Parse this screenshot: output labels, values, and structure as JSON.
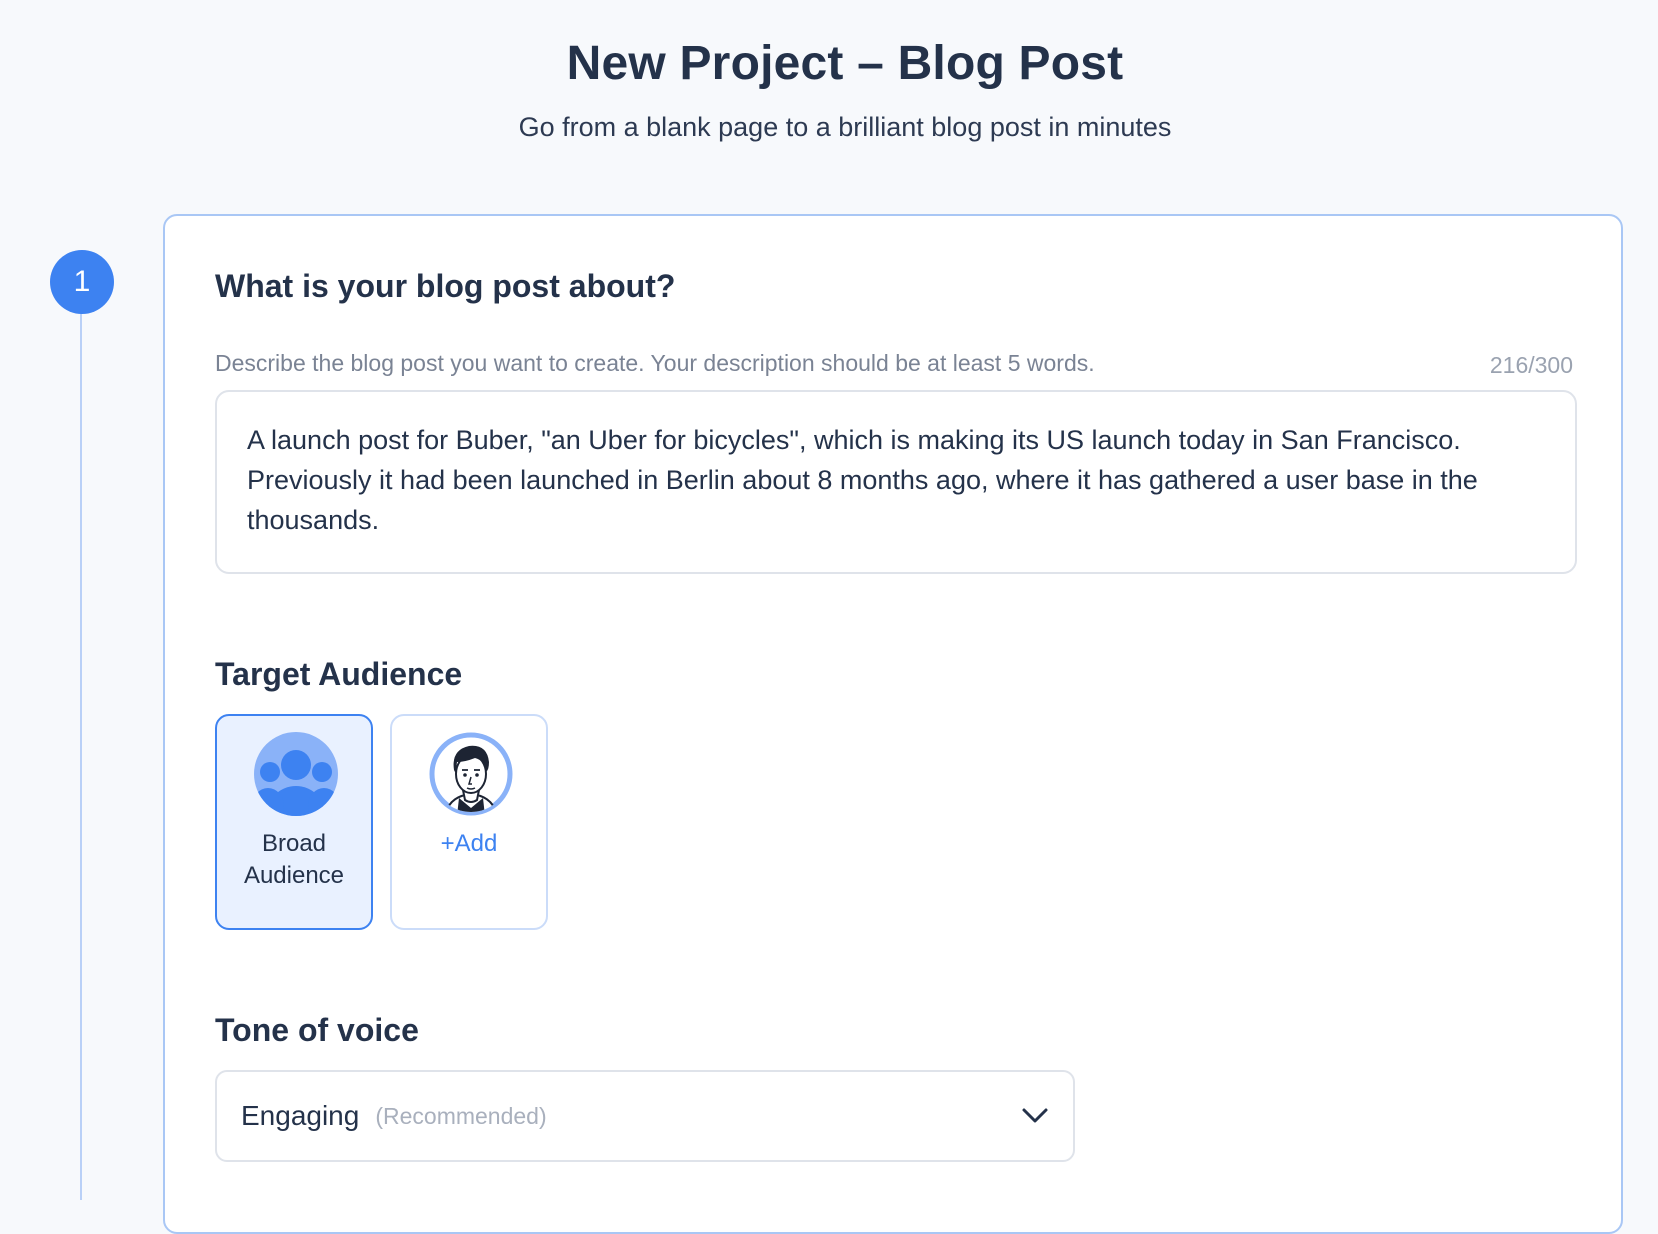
{
  "header": {
    "title": "New Project – Blog Post",
    "subtitle": "Go from a blank page to a brilliant blog post in minutes"
  },
  "step": {
    "number": "1"
  },
  "description": {
    "heading": "What is your blog post about?",
    "helper": "Describe the blog post you want to create. Your description should be at least 5 words.",
    "counter": "216/300",
    "value": "A launch post for Buber, \"an Uber for bicycles\", which is making its US launch today in San Francisco. Previously it had been launched in Berlin about 8 months ago, where it has gathered a user base in the thousands."
  },
  "audience": {
    "heading": "Target Audience",
    "options": [
      {
        "label": "Broad Audience",
        "icon": "group-icon",
        "selected": true
      },
      {
        "label": "+Add",
        "icon": "person-avatar-icon",
        "selected": false
      }
    ]
  },
  "tone": {
    "heading": "Tone of voice",
    "value": "Engaging",
    "hint": "(Recommended)",
    "icon": "chevron-down-icon"
  },
  "colors": {
    "accent": "#3d82f1",
    "selected_bg": "#e9f1ff",
    "text": "#24324a",
    "background": "#f7f9fc"
  }
}
